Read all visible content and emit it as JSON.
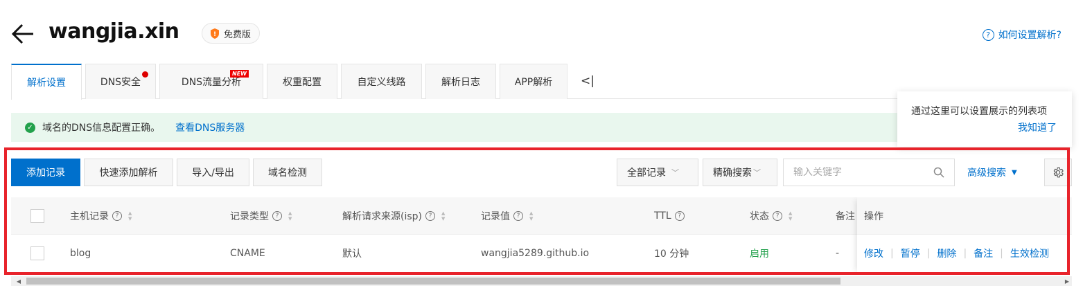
{
  "header": {
    "domain": "wangjia.xin",
    "plan_badge": "免费版",
    "help_link": "如何设置解析?"
  },
  "tabs": [
    {
      "label": "解析设置",
      "active": true
    },
    {
      "label": "DNS安全",
      "dot": true
    },
    {
      "label": "DNS流量分析",
      "badge": "NEW"
    },
    {
      "label": "权重配置"
    },
    {
      "label": "自定义线路"
    },
    {
      "label": "解析日志"
    },
    {
      "label": "APP解析"
    }
  ],
  "tabs_collapse": "<|",
  "notice": {
    "message": "域名的DNS信息配置正确。",
    "link": "查看DNS服务器"
  },
  "tooltip": {
    "text": "通过这里可以设置展示的列表项",
    "dismiss": "我知道了"
  },
  "toolbar": {
    "add_record": "添加记录",
    "quick_add": "快速添加解析",
    "import_export": "导入/导出",
    "domain_check": "域名检测",
    "record_filter": "全部记录",
    "search_mode": "精确搜索",
    "search_placeholder": "输入关键字",
    "advanced_search": "高级搜索"
  },
  "table": {
    "columns": {
      "host": "主机记录",
      "type": "记录类型",
      "isp": "解析请求来源(isp)",
      "value": "记录值",
      "ttl": "TTL",
      "status": "状态",
      "remark": "备注",
      "actions": "操作"
    },
    "rows": [
      {
        "host": "blog",
        "type": "CNAME",
        "isp": "默认",
        "value": "wangjia5289.github.io",
        "ttl": "10 分钟",
        "status": "启用",
        "remark": "-",
        "actions": [
          "修改",
          "暂停",
          "删除",
          "备注",
          "生效检测"
        ]
      }
    ]
  },
  "colors": {
    "accent": "#0070cc",
    "success": "#23a14c",
    "highlight_border": "#e8232b"
  }
}
